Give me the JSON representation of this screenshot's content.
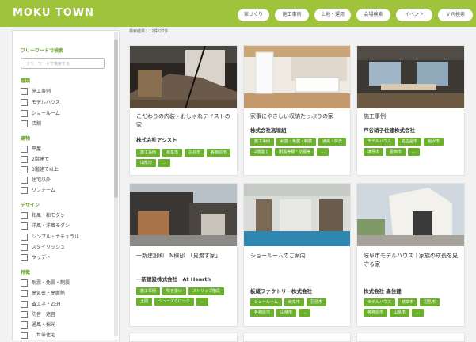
{
  "header": {
    "logo": "MOKU TOWN",
    "nav": [
      "家づくり",
      "施工事例",
      "土地・運用",
      "会場検索",
      "イベント",
      "ＶＲ検索"
    ]
  },
  "results_count": "検索結果：12件/27件",
  "sidebar": {
    "freeword_title": "フリーワードで検索",
    "freeword_placeholder": "フリーワードで検索する",
    "sections": [
      {
        "title": "種類",
        "items": [
          "施工事例",
          "モデルハウス",
          "ショールーム",
          "店舗"
        ]
      },
      {
        "title": "建物",
        "items": [
          "平屋",
          "2階建て",
          "3階建て以上",
          "住宅以外",
          "リフォーム"
        ]
      },
      {
        "title": "デザイン",
        "items": [
          "和風・和モダン",
          "洋風・洋風モダン",
          "シンプル・ナチュラル",
          "スタイリッシュ",
          "ウッディ"
        ]
      },
      {
        "title": "特徴",
        "items": [
          "耐震・免震・制震",
          "高気密・高断熱",
          "省エネ・ZEH",
          "防音・遮音",
          "通風・採光",
          "二世帯住宅"
        ]
      }
    ]
  },
  "cards": [
    {
      "title": "こだわりの内装・おしゃれテイストの家",
      "company": "株式会社アシスト",
      "tags": [
        "施工事例",
        "岐阜市",
        "羽島市",
        "各務原市",
        "山県市",
        "..."
      ]
    },
    {
      "title": "家事にやさしい収納たっぷりの家",
      "company": "株式会社高垣組",
      "tags": [
        "施工事例",
        "耐震・免震・制震",
        "通風・採光",
        "2階建て",
        "耐震等級・防振等",
        "..."
      ]
    },
    {
      "title": "施工事例",
      "company": "戸谷硝子住建株式会社",
      "tags": [
        "モデルハウス",
        "名古屋市",
        "稲沢市",
        "津島市",
        "愛西市",
        "..."
      ]
    },
    {
      "title": "一新建設㈱　N様邸　「見渡す家」",
      "company": "一新建設株式会社　At Hearth",
      "tags": [
        "施工事例",
        "吹き抜け",
        "ストリップ階段",
        "土間",
        "シューズクローク",
        "..."
      ]
    },
    {
      "title": "ショールームのご案内",
      "company": "板蔵ファクトリー株式会社",
      "tags": [
        "ショールーム",
        "岐阜市",
        "羽島市",
        "各務原市",
        "山県市",
        "..."
      ]
    },
    {
      "title": "岐阜市モデルハウス｜家族の成長を見守る家",
      "company": "株式会社 森住建",
      "tags": [
        "モデルハウス",
        "岐阜市",
        "羽島市",
        "各務原市",
        "山県市",
        "..."
      ]
    }
  ]
}
